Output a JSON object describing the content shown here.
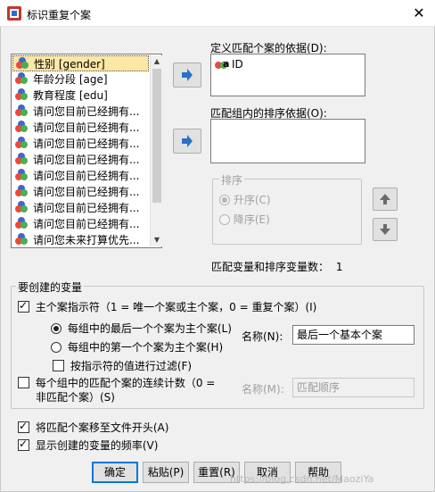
{
  "window": {
    "title": "标识重复个案",
    "close_glyph": "✕"
  },
  "variable_list": {
    "items": [
      {
        "label": "性别 [gender]",
        "selected": true
      },
      {
        "label": "年龄分段 [age]"
      },
      {
        "label": "教育程度 [edu]"
      },
      {
        "label": "请问您目前已经拥有..."
      },
      {
        "label": "请问您目前已经拥有..."
      },
      {
        "label": "请问您目前已经拥有..."
      },
      {
        "label": "请问您目前已经拥有..."
      },
      {
        "label": "请问您目前已经拥有..."
      },
      {
        "label": "请问您目前已经拥有..."
      },
      {
        "label": "请问您目前已经拥有..."
      },
      {
        "label": "请问您目前已经拥有..."
      },
      {
        "label": "请问您未来打算优先..."
      }
    ]
  },
  "match_by": {
    "label": "定义匹配个案的依据(D):",
    "items": [
      "ID"
    ]
  },
  "sort_within": {
    "label": "匹配组内的排序依据(O):"
  },
  "sort_order": {
    "title": "排序",
    "ascending": "升序(C)",
    "descending": "降序(E)"
  },
  "match_sort_count": {
    "label": "匹配变量和排序变量数：",
    "value": "1"
  },
  "variables_to_create": {
    "title": "要创建的变量",
    "primary_indicator": "主个案指示符（1 = 唯一个案或主个案，0 = 重复个案）(I)",
    "last_case": "每组中的最后一个个案为主个案(L)",
    "first_case": "每组中的第一个个案为主个案(H)",
    "filter": "按指示符的值进行过滤(F)",
    "name_label": "名称(N):",
    "name_value": "最后一个基本个案",
    "sequential_line1": "每个组中的匹配个案的连续计数（0 =",
    "sequential_line2": "非匹配个案）(S)",
    "name2_label": "名称(M):",
    "name2_value": "匹配顺序"
  },
  "options": {
    "move_to_top": "将匹配个案移至文件开头(A)",
    "display_freq": "显示创建的变量的频率(V)"
  },
  "buttons": {
    "ok": "确定",
    "paste": "粘贴(P)",
    "reset": "重置(R)",
    "cancel": "取消",
    "help": "帮助"
  },
  "watermark": "https://blog.csdn.net/MaoziYa"
}
